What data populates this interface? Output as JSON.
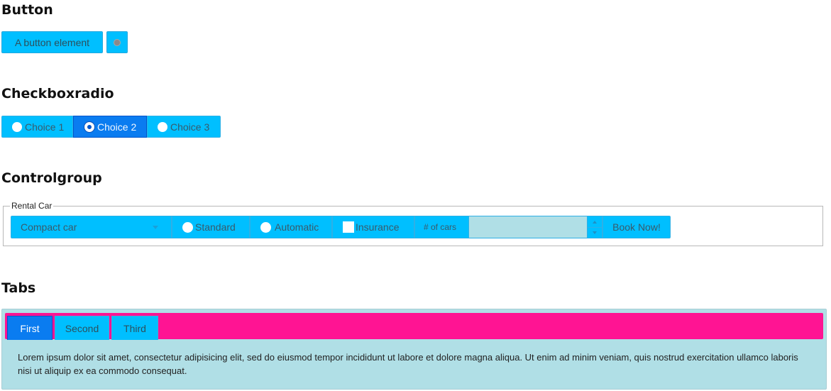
{
  "sections": {
    "button": "Button",
    "checkboxradio": "Checkboxradio",
    "controlgroup": "Controlgroup",
    "tabs": "Tabs"
  },
  "button_demo": {
    "button_label": "A button element",
    "icon_button_icon": "gear-icon"
  },
  "checkboxradio_demo": {
    "choices": [
      "Choice 1",
      "Choice 2",
      "Choice 3"
    ],
    "selected": "Choice 2"
  },
  "controlgroup_demo": {
    "legend": "Rental Car",
    "select_value": "Compact car",
    "radio_standard": "Standard",
    "radio_automatic": "Automatic",
    "checkbox_insurance": "Insurance",
    "spinner_label": "# of cars",
    "spinner_value": "",
    "book_button": "Book Now!"
  },
  "tabs_demo": {
    "tabs": [
      "First",
      "Second",
      "Third"
    ],
    "active_tab": "First",
    "panel_text": "Lorem ipsum dolor sit amet, consectetur adipisicing elit, sed do eiusmod tempor incididunt ut labore et dolore magna aliqua. Ut enim ad minim veniam, quis nostrud exercitation ullamco laboris nisi ut aliquip ex ea commodo consequat."
  },
  "colors": {
    "widget_bg": "#00bfff",
    "active_bg": "#0a7cf0",
    "tabbar_bg": "#ff1493",
    "panel_bg": "#b0dfe6"
  }
}
